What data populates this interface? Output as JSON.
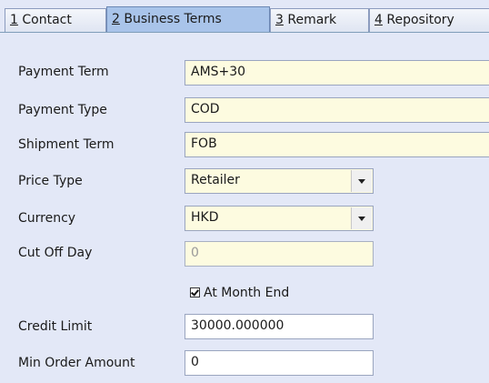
{
  "tabs": [
    {
      "num": "1",
      "label": " Contact"
    },
    {
      "num": "2",
      "label": " Business Terms"
    },
    {
      "num": "3",
      "label": " Remark"
    },
    {
      "num": "4",
      "label": " Repository"
    }
  ],
  "form": {
    "payment_term": {
      "label": "Payment Term",
      "value": "AMS+30"
    },
    "payment_type": {
      "label": "Payment Type",
      "value": "COD"
    },
    "shipment_term": {
      "label": "Shipment Term",
      "value": "FOB"
    },
    "price_type": {
      "label": "Price Type",
      "value": "Retailer"
    },
    "currency": {
      "label": "Currency",
      "value": "HKD"
    },
    "cut_off_day": {
      "label": "Cut Off Day",
      "value": "0"
    },
    "at_month_end": {
      "label": "At Month End",
      "checked": true
    },
    "credit_limit": {
      "label": "Credit Limit",
      "value": "30000.000000"
    },
    "min_order_amount": {
      "label": "Min Order Amount",
      "value": "0"
    }
  },
  "colors": {
    "background": "#e3e8f7",
    "active_tab": "#a9c4ea",
    "field_yellow": "#fdfbe0",
    "field_white": "#ffffff"
  }
}
